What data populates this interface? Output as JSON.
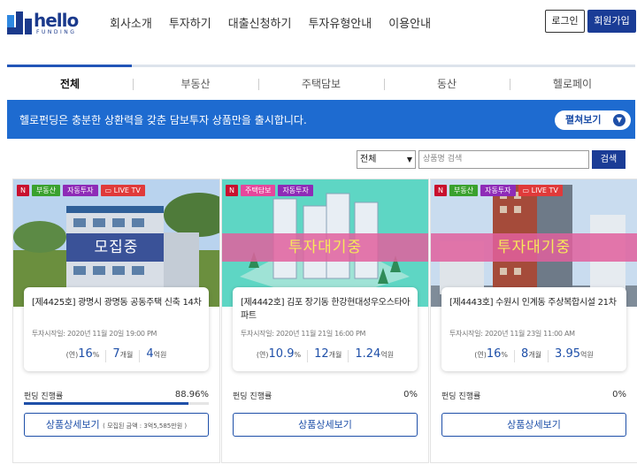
{
  "header": {
    "logo_text": "hello",
    "logo_sub": "FUNDING",
    "nav": [
      "회사소개",
      "투자하기",
      "대출신청하기",
      "투자유형안내",
      "이용안내"
    ],
    "login": "로그인",
    "join": "회원가입"
  },
  "tabs": [
    "전체",
    "부동산",
    "주택담보",
    "동산",
    "헬로페이"
  ],
  "banner": {
    "text": "헬로펀딩은 충분한 상환력을 갖춘 담보투자 상품만을 출시합니다.",
    "more": "펼쳐보기"
  },
  "search": {
    "select": "전체",
    "placeholder": "상품명 검색",
    "button": "검색"
  },
  "colors": {
    "primary": "#1a3c96",
    "accent": "#1e6bd0"
  },
  "cards": [
    {
      "tags": [
        "N",
        "부동산",
        "자동투자",
        "LIVE TV"
      ],
      "overlay": "모집중",
      "title": "[제4425호] 광명시 광명동 공동주택 신축 14차",
      "date": "투자시작일: 2020년 11월 20일 19:00 PM",
      "rate_pre": "(연)",
      "rate": "16",
      "rate_unit": "%",
      "term": "7",
      "term_unit": "개월",
      "amount": "4",
      "amount_unit": "억원",
      "prog_label": "펀딩 진행률",
      "prog": "88.96%",
      "prog_value": 88.96,
      "detail": "상품상세보기",
      "detail_sub": "( 모집된 금액 : 3억5,585만원 )"
    },
    {
      "tags": [
        "N",
        "주택담보",
        "자동투자"
      ],
      "overlay": "투자대기중",
      "title": "[제4442호] 김포 장기동 한강현대성우오스타아파트",
      "date": "투자시작일: 2020년 11월 21일 16:00 PM",
      "rate_pre": "(연)",
      "rate": "10.9",
      "rate_unit": "%",
      "term": "12",
      "term_unit": "개월",
      "amount": "1.24",
      "amount_unit": "억원",
      "prog_label": "펀딩 진행률",
      "prog": "0%",
      "prog_value": 0,
      "detail": "상품상세보기",
      "detail_sub": ""
    },
    {
      "tags": [
        "N",
        "부동산",
        "자동투자",
        "LIVE TV"
      ],
      "overlay": "투자대기중",
      "title": "[제4443호] 수원시 인계동 주상복합시설 21차",
      "date": "투자시작일: 2020년 11월 23일 11:00 AM",
      "rate_pre": "(연)",
      "rate": "16",
      "rate_unit": "%",
      "term": "8",
      "term_unit": "개월",
      "amount": "3.95",
      "amount_unit": "억원",
      "prog_label": "펀딩 진행률",
      "prog": "0%",
      "prog_value": 0,
      "detail": "상품상세보기",
      "detail_sub": ""
    }
  ]
}
